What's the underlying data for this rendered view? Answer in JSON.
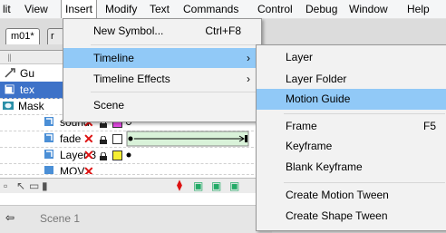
{
  "menubar": {
    "items": [
      "lit",
      "View",
      "Insert",
      "Modify",
      "Text",
      "Commands",
      "Control",
      "Debug",
      "Window",
      "Help"
    ]
  },
  "document": {
    "tab_label": "m01*",
    "tab2_label": "r"
  },
  "layers": [
    {
      "name": "Gu",
      "kind": "guide"
    },
    {
      "name": "tex",
      "kind": "text"
    },
    {
      "name": "Mask",
      "kind": "mask"
    },
    {
      "name": "sound",
      "kind": "layer"
    },
    {
      "name": "fade",
      "kind": "layer"
    },
    {
      "name": "Layer 3",
      "kind": "layer"
    },
    {
      "name": "MOV",
      "kind": "layer"
    }
  ],
  "insert_menu": {
    "items": [
      {
        "label": "New Symbol...",
        "shortcut": "Ctrl+F8",
        "submenu": false
      },
      {
        "label": "Timeline",
        "shortcut": "",
        "submenu": true,
        "highlighted": true
      },
      {
        "label": "Timeline Effects",
        "shortcut": "",
        "submenu": true
      },
      {
        "label": "Scene",
        "shortcut": "",
        "submenu": false
      }
    ]
  },
  "timeline_submenu": {
    "items": [
      {
        "label": "Layer",
        "shortcut": ""
      },
      {
        "label": "Layer Folder",
        "shortcut": ""
      },
      {
        "label": "Motion Guide",
        "shortcut": "",
        "highlighted": true
      },
      {
        "label": "Frame",
        "shortcut": "F5"
      },
      {
        "label": "Keyframe",
        "shortcut": ""
      },
      {
        "label": "Blank Keyframe",
        "shortcut": ""
      },
      {
        "label": "Create Motion Tween",
        "shortcut": ""
      },
      {
        "label": "Create Shape Tween",
        "shortcut": ""
      }
    ]
  },
  "bottom_row": {
    "partial_label": "Scene 1"
  },
  "colors": {
    "selection": "#3d72c8",
    "menu_highlight": "#91c9f7"
  }
}
